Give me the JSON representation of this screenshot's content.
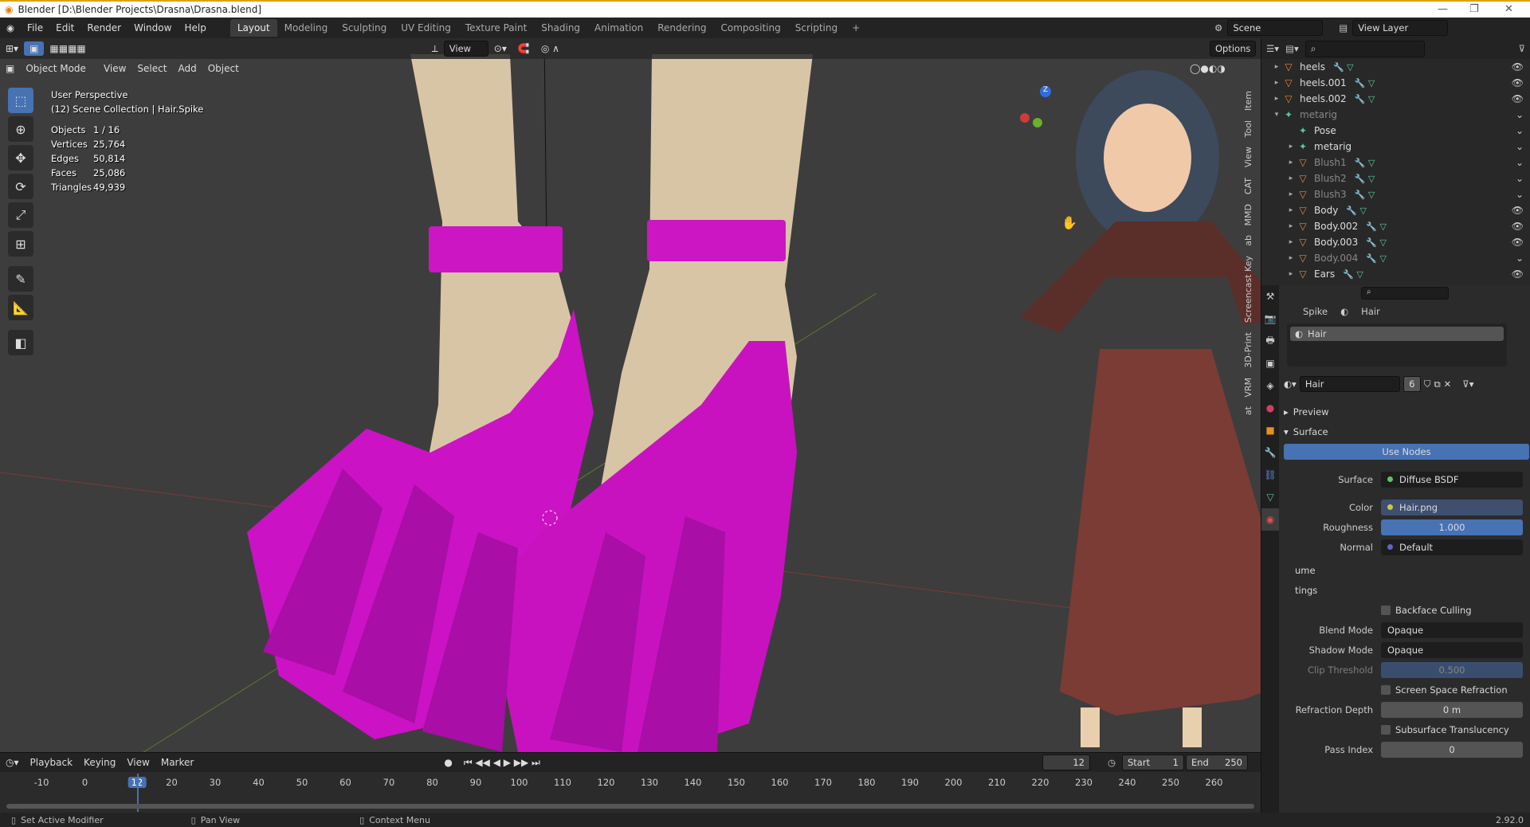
{
  "window": {
    "title": "Blender [D:\\Blender Projects\\Drasna\\Drasna.blend]"
  },
  "menus": [
    "File",
    "Edit",
    "Render",
    "Window",
    "Help"
  ],
  "workspaces": [
    "Layout",
    "Modeling",
    "Sculpting",
    "UV Editing",
    "Texture Paint",
    "Shading",
    "Animation",
    "Rendering",
    "Compositing",
    "Scripting"
  ],
  "active_workspace": "Layout",
  "scene": {
    "name": "Scene",
    "view_layer": "View Layer"
  },
  "viewport": {
    "mode": "Object Mode",
    "menus": [
      "View",
      "Select",
      "Add",
      "Object"
    ],
    "transform_orientation": "View",
    "options_label": "Options",
    "perspective": "User Perspective",
    "collection": "(12) Scene Collection | Hair.Spike",
    "stats": [
      {
        "k": "Objects",
        "v": "1 / 16"
      },
      {
        "k": "Vertices",
        "v": "25,764"
      },
      {
        "k": "Edges",
        "v": "50,814"
      },
      {
        "k": "Faces",
        "v": "25,086"
      },
      {
        "k": "Triangles",
        "v": "49,939"
      }
    ],
    "side_tabs": [
      "Item",
      "Tool",
      "View",
      "CAT",
      "MMD",
      "ab",
      "Screencast Key",
      "3D-Print",
      "VRM",
      "at"
    ]
  },
  "outliner": {
    "rows": [
      {
        "label": "heels",
        "type": "mesh",
        "dim": false,
        "visible": true
      },
      {
        "label": "heels.001",
        "type": "mesh",
        "dim": false,
        "visible": true
      },
      {
        "label": "heels.002",
        "type": "mesh",
        "dim": false,
        "visible": true
      },
      {
        "label": "metarig",
        "type": "armature",
        "dim": true,
        "visible": false
      },
      {
        "label": "Pose",
        "type": "pose",
        "dim": false,
        "visible": false
      },
      {
        "label": "metarig",
        "type": "armature",
        "dim": false,
        "visible": false
      },
      {
        "label": "Blush1",
        "type": "mesh",
        "dim": true,
        "visible": false
      },
      {
        "label": "Blush2",
        "type": "mesh",
        "dim": true,
        "visible": false
      },
      {
        "label": "Blush3",
        "type": "mesh",
        "dim": true,
        "visible": false
      },
      {
        "label": "Body",
        "type": "mesh",
        "dim": false,
        "visible": true
      },
      {
        "label": "Body.002",
        "type": "mesh",
        "dim": false,
        "visible": true
      },
      {
        "label": "Body.003",
        "type": "mesh",
        "dim": false,
        "visible": true
      },
      {
        "label": "Body.004",
        "type": "mesh",
        "dim": true,
        "visible": false
      },
      {
        "label": "Ears",
        "type": "mesh",
        "dim": false,
        "visible": true
      }
    ]
  },
  "properties": {
    "breadcrumb_object": "Spike",
    "breadcrumb_material": "Hair",
    "slot": "Hair",
    "material_name": "Hair",
    "users": "6",
    "sections": {
      "preview": "Preview",
      "surface": "Surface",
      "volume": "ume",
      "settings": "tings"
    },
    "use_nodes": "Use Nodes",
    "surface": {
      "label": "Surface",
      "value": "Diffuse BSDF"
    },
    "color": {
      "label": "Color",
      "value": "Hair.png"
    },
    "roughness": {
      "label": "Roughness",
      "value": "1.000"
    },
    "normal": {
      "label": "Normal",
      "value": "Default"
    },
    "backface_culling": "Backface Culling",
    "blend_mode": {
      "label": "Blend Mode",
      "value": "Opaque"
    },
    "shadow_mode": {
      "label": "Shadow Mode",
      "value": "Opaque"
    },
    "clip_threshold": {
      "label": "Clip Threshold",
      "value": "0.500"
    },
    "ssr": "Screen Space Refraction",
    "refraction_depth": {
      "label": "Refraction Depth",
      "value": "0 m"
    },
    "sss": "Subsurface Translucency",
    "pass_index": {
      "label": "Pass Index",
      "value": "0"
    }
  },
  "timeline": {
    "menus": [
      "Playback",
      "Keying",
      "View",
      "Marker"
    ],
    "current_frame": "12",
    "start_label": "Start",
    "start": "1",
    "end_label": "End",
    "end": "250",
    "ticks": [
      "-10",
      "0",
      "12",
      "20",
      "30",
      "40",
      "50",
      "60",
      "70",
      "80",
      "90",
      "100",
      "110",
      "120",
      "130",
      "140",
      "150",
      "160",
      "170",
      "180",
      "190",
      "200",
      "210",
      "220",
      "230",
      "240",
      "250",
      "260"
    ]
  },
  "statusbar": {
    "left": "Set Active Modifier",
    "mid": "Pan View",
    "right": "Context Menu",
    "version": "2.92.0"
  }
}
